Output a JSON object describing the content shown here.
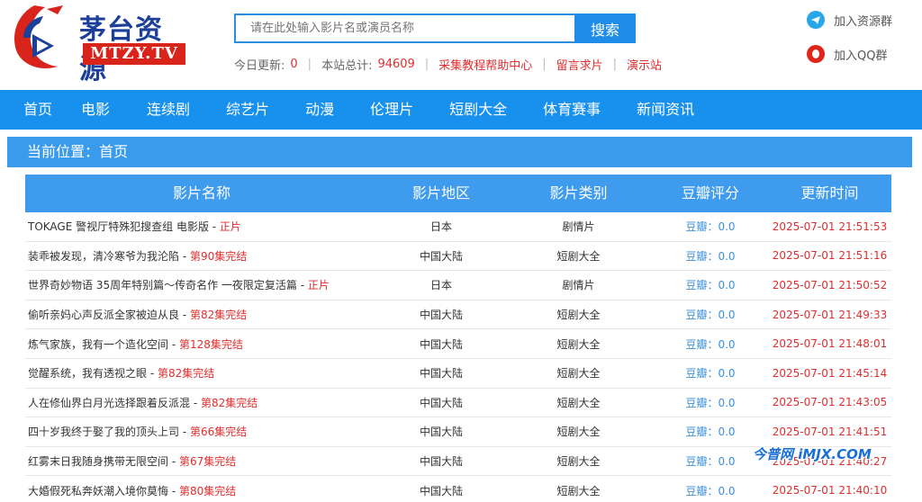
{
  "brand": {
    "name": "茅台资源",
    "domain": "MTZY.TV",
    "colors": {
      "primary": "#1890ee",
      "accent_red": "#e02e2e",
      "logo_blue": "#1c3f9a"
    }
  },
  "search": {
    "placeholder": "请在此处输入影片名或演员名称",
    "button_label": "搜索"
  },
  "stats": {
    "today_label": "今日更新:",
    "today_value": "0",
    "total_label": "本站总计:",
    "total_value": "94609",
    "help_link": "采集教程帮助中心",
    "request_link": "留言求片",
    "demo_link": "演示站"
  },
  "header_links": {
    "telegram": {
      "label": "加入资源群",
      "icon": "telegram-icon"
    },
    "qq": {
      "label": "加入QQ群",
      "icon": "qq-icon"
    }
  },
  "nav": {
    "items": [
      "首页",
      "电影",
      "连续剧",
      "综艺片",
      "动漫",
      "伦理片",
      "短剧大全",
      "体育赛事",
      "新闻资讯"
    ]
  },
  "breadcrumb": "当前位置：首页",
  "table": {
    "headers": [
      "影片名称",
      "影片地区",
      "影片类别",
      "豆瓣评分",
      "更新时间"
    ],
    "rows": [
      {
        "title": "TOKAGE 警视厅特殊犯搜查组 电影版",
        "sep": " - ",
        "status": "正片",
        "region": "日本",
        "category": "剧情片",
        "rating": "豆瓣：0.0",
        "time": "2025-07-01 21:51:53"
      },
      {
        "title": "装乖被发现，清冷寒爷为我沦陷",
        "sep": " - ",
        "status": "第90集完结",
        "region": "中国大陆",
        "category": "短剧大全",
        "rating": "豆瓣：0.0",
        "time": "2025-07-01 21:51:16"
      },
      {
        "title": "世界奇妙物语 35周年特别篇～传奇名作 一夜限定复活篇",
        "sep": " - ",
        "status": "正片",
        "region": "日本",
        "category": "剧情片",
        "rating": "豆瓣：0.0",
        "time": "2025-07-01 21:50:52"
      },
      {
        "title": "偷听亲妈心声反派全家被迫从良",
        "sep": " - ",
        "status": "第82集完结",
        "region": "中国大陆",
        "category": "短剧大全",
        "rating": "豆瓣：0.0",
        "time": "2025-07-01 21:49:33"
      },
      {
        "title": "炼气家族，我有一个造化空间",
        "sep": " - ",
        "status": "第128集完结",
        "region": "中国大陆",
        "category": "短剧大全",
        "rating": "豆瓣：0.0",
        "time": "2025-07-01 21:48:01"
      },
      {
        "title": "觉醒系统，我有透视之眼",
        "sep": " - ",
        "status": "第82集完结",
        "region": "中国大陆",
        "category": "短剧大全",
        "rating": "豆瓣：0.0",
        "time": "2025-07-01 21:45:14"
      },
      {
        "title": "人在修仙界白月光选择跟着反派混",
        "sep": " - ",
        "status": "第82集完结",
        "region": "中国大陆",
        "category": "短剧大全",
        "rating": "豆瓣：0.0",
        "time": "2025-07-01 21:43:05"
      },
      {
        "title": "四十岁我终于娶了我的顶头上司",
        "sep": " - ",
        "status": "第66集完结",
        "region": "中国大陆",
        "category": "短剧大全",
        "rating": "豆瓣：0.0",
        "time": "2025-07-01 21:41:51"
      },
      {
        "title": "红雾末日我随身携带无限空间",
        "sep": " - ",
        "status": "第67集完结",
        "region": "中国大陆",
        "category": "短剧大全",
        "rating": "豆瓣：0.0",
        "time": "2025-07-01 21:40:27"
      },
      {
        "title": "大婚假死私奔妖潮入境你莫悔",
        "sep": " - ",
        "status": "第80集完结",
        "region": "中国大陆",
        "category": "短剧大全",
        "rating": "豆瓣：0.0",
        "time": "2025-07-01 21:40:10"
      }
    ]
  },
  "watermark": "今普网 iMJX.COM"
}
